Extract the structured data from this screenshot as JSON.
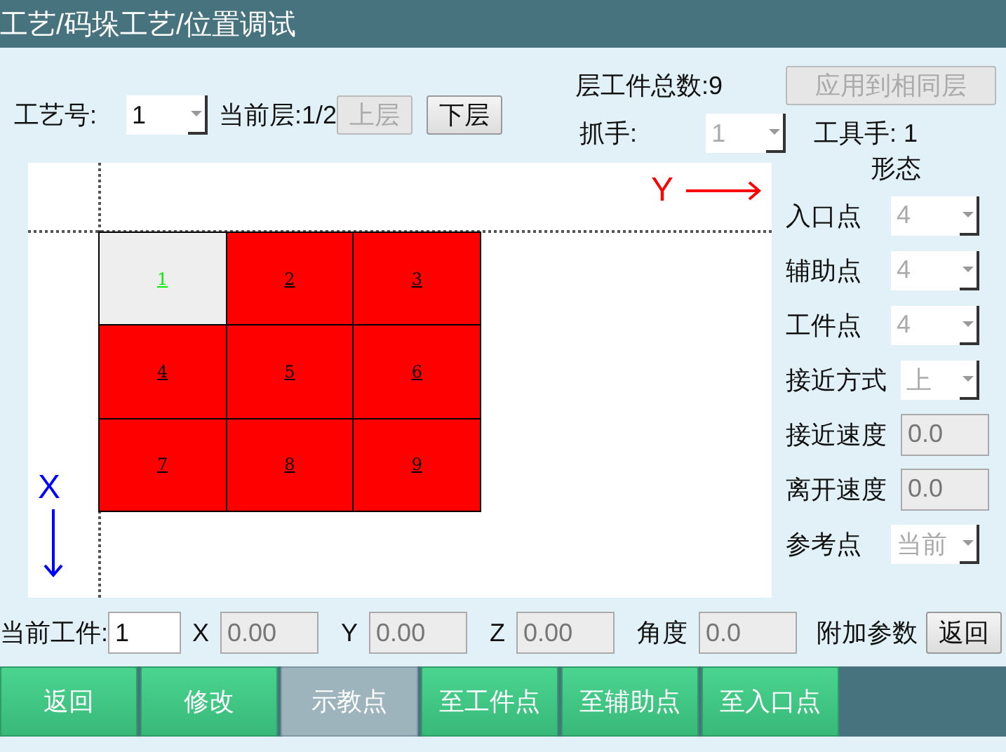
{
  "window": {
    "title": "工艺/码垛工艺/位置调试"
  },
  "process_no": {
    "label": "工艺号:",
    "value": "1",
    "disabled": false
  },
  "current_layer": "当前层:1/2",
  "layer_buttons": [
    {
      "label": "上层",
      "disabled": true
    },
    {
      "label": "下层",
      "disabled": false
    }
  ],
  "layer_total": "层工件总数:9",
  "apply_button": {
    "label": "应用到相同层",
    "disabled": true
  },
  "gripper": {
    "label": "抓手:",
    "value": "1",
    "disabled": true
  },
  "tool": "工具手: 1",
  "canvas": {
    "y_axis": "Y",
    "x_axis": "X",
    "cells": [
      {
        "label": "1",
        "selected": true
      },
      {
        "label": "2",
        "selected": false
      },
      {
        "label": "3",
        "selected": false
      },
      {
        "label": "4",
        "selected": false
      },
      {
        "label": "5",
        "selected": false
      },
      {
        "label": "6",
        "selected": false
      },
      {
        "label": "7",
        "selected": false
      },
      {
        "label": "8",
        "selected": false
      },
      {
        "label": "9",
        "selected": false
      }
    ]
  },
  "pose": {
    "title": "形态",
    "fields": [
      {
        "kind": "select",
        "label": "入口点",
        "value": "4",
        "disabled": true
      },
      {
        "kind": "select",
        "label": "辅助点",
        "value": "4",
        "disabled": true
      },
      {
        "kind": "select",
        "label": "工件点",
        "value": "4",
        "disabled": true
      },
      {
        "kind": "select",
        "label": "接近方式",
        "value": "上",
        "disabled": true
      },
      {
        "kind": "input",
        "label": "接近速度",
        "value": "0.0",
        "disabled": true
      },
      {
        "kind": "input",
        "label": "离开速度",
        "value": "0.0",
        "disabled": true
      },
      {
        "kind": "select",
        "label": "参考点",
        "value": "当前",
        "disabled": true
      }
    ]
  },
  "current_workpiece": {
    "label": "当前工件:",
    "value": "1"
  },
  "coords": [
    {
      "label": "X",
      "value": "0.00"
    },
    {
      "label": "Y",
      "value": "0.00"
    },
    {
      "label": "Z",
      "value": "0.00"
    },
    {
      "label": "角度",
      "value": "0.0"
    }
  ],
  "extra_label": "附加参数",
  "back_button": "返回",
  "footer": [
    {
      "label": "返回",
      "selected": false
    },
    {
      "label": "修改",
      "selected": false
    },
    {
      "label": "示教点",
      "selected": true
    },
    {
      "label": "至工件点",
      "selected": false
    },
    {
      "label": "至辅助点",
      "selected": false
    },
    {
      "label": "至入口点",
      "selected": false
    }
  ]
}
